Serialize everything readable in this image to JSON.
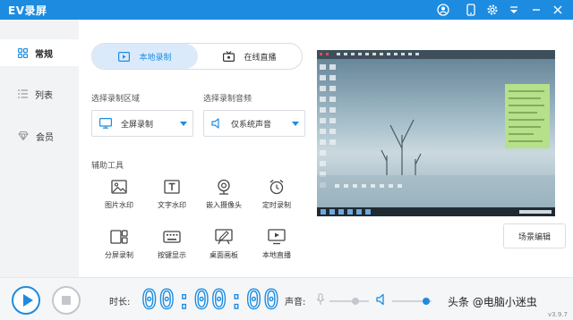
{
  "app": {
    "title": "EV录屏"
  },
  "titlebar_icons": [
    "user-icon",
    "mobile-icon",
    "settings-icon",
    "menu-down-icon",
    "minimize-icon",
    "close-icon"
  ],
  "sidebar": {
    "items": [
      {
        "label": "常规",
        "icon": "grid-icon",
        "active": true
      },
      {
        "label": "列表",
        "icon": "list-icon",
        "active": false
      },
      {
        "label": "会员",
        "icon": "diamond-icon",
        "active": false
      }
    ]
  },
  "mode": {
    "local_record": "本地录制",
    "live_stream": "在线直播",
    "active": "本地录制"
  },
  "area": {
    "label": "选择录制区域",
    "value": "全屏录制"
  },
  "audio": {
    "label": "选择录制音频",
    "value": "仅系统声音"
  },
  "tools": {
    "label": "辅助工具",
    "items": [
      {
        "label": "图片水印",
        "icon": "image-icon"
      },
      {
        "label": "文字水印",
        "icon": "text-icon"
      },
      {
        "label": "嵌入摄像头",
        "icon": "webcam-icon"
      },
      {
        "label": "定时录制",
        "icon": "alarm-clock-icon"
      },
      {
        "label": "分屏录制",
        "icon": "split-screen-icon"
      },
      {
        "label": "按键显示",
        "icon": "keyboard-icon"
      },
      {
        "label": "桌面画板",
        "icon": "drawing-board-icon"
      },
      {
        "label": "本地直播",
        "icon": "tv-icon"
      }
    ]
  },
  "scene_edit": "场景编辑",
  "bottom": {
    "time_label": "时长:",
    "timer": "00:00:00",
    "volume_label": "声音:",
    "mic_level": 0.7,
    "system_level": 0.95
  },
  "watermark": "头条 @电脑小迷虫",
  "version": "v3.9.7",
  "colors": {
    "accent": "#1d8ce0",
    "sidebar_bg": "#f2f3f5"
  }
}
